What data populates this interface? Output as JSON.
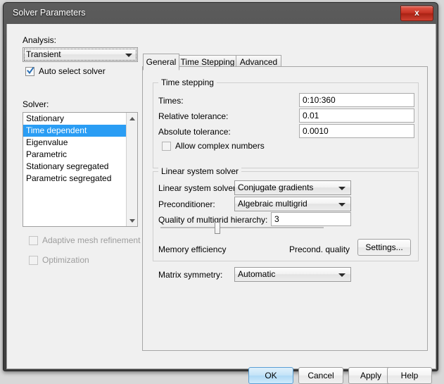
{
  "window": {
    "title": "Solver Parameters",
    "close_label": "x",
    "close_icon": "close-icon"
  },
  "left_panel": {
    "analysis_label": "Analysis:",
    "analysis_value": "Transient",
    "auto_select_label": "Auto select solver",
    "auto_select_checked": true,
    "solver_label": "Solver:",
    "solver_items": [
      "Stationary",
      "Time dependent",
      "Eigenvalue",
      "Parametric",
      "Stationary segregated",
      "Parametric segregated"
    ],
    "solver_selected": "Time dependent",
    "adaptive_mesh_label": "Adaptive mesh refinement",
    "adaptive_mesh_checked": false,
    "adaptive_mesh_enabled": false,
    "optimization_label": "Optimization",
    "optimization_checked": false,
    "optimization_enabled": false
  },
  "tabs": [
    {
      "label": "General",
      "active": true
    },
    {
      "label": "Time Stepping",
      "active": false
    },
    {
      "label": "Advanced",
      "active": false
    }
  ],
  "time_stepping": {
    "group_title": "Time stepping",
    "times_label": "Times:",
    "times_value": "0:10:360",
    "rel_tol_label": "Relative tolerance:",
    "rel_tol_value": "0.01",
    "abs_tol_label": "Absolute tolerance:",
    "abs_tol_value": "0.0010",
    "allow_complex_label": "Allow complex numbers",
    "allow_complex_checked": false
  },
  "linear_solver": {
    "group_title": "Linear system solver",
    "solver_label": "Linear system solver:",
    "solver_value": "Conjugate gradients",
    "precond_label": "Preconditioner:",
    "precond_value": "Algebraic multigrid",
    "quality_label": "Quality of multigrid hierarchy:",
    "quality_value": "3",
    "slider_position_percent": 33,
    "slider_left_label": "Memory efficiency",
    "slider_right_label": "Precond. quality",
    "settings_label": "Settings..."
  },
  "matrix": {
    "label": "Matrix symmetry:",
    "value": "Automatic"
  },
  "buttons": {
    "ok": "OK",
    "cancel": "Cancel",
    "apply": "Apply",
    "help": "Help"
  },
  "colors": {
    "selection_blue": "#2a9df4",
    "close_red": "#c43022",
    "dialog_bg": "#f0f0f0",
    "default_button_blue": "#aed9f5"
  }
}
